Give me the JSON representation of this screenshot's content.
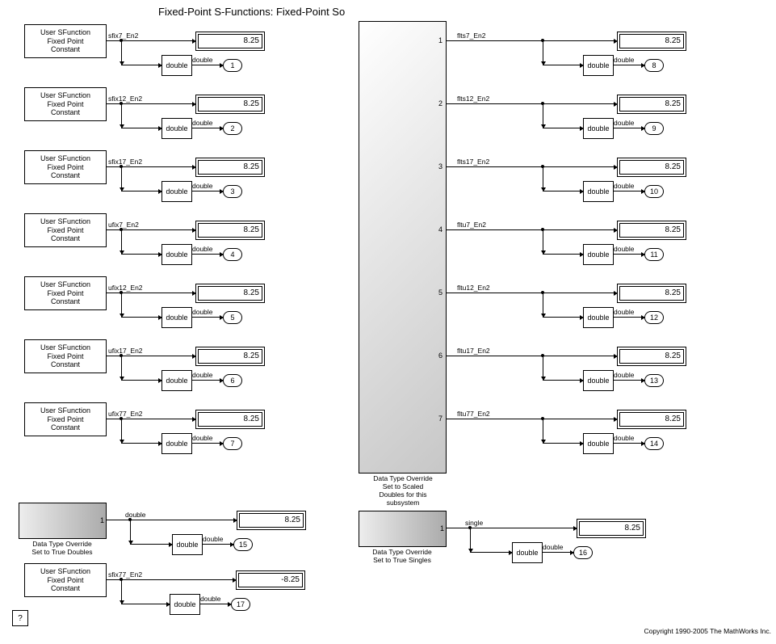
{
  "title": "Fixed-Point S-Functions: Fixed-Point So",
  "src_label": "User SFunction\nFixed Point\nConstant",
  "double_label": "double",
  "help": "?",
  "copyright": "Copyright 1990-2005 The MathWorks Inc.",
  "left_rows": [
    {
      "sig": "sfix7_En2",
      "disp": "8.25",
      "out": "1"
    },
    {
      "sig": "sfix12_En2",
      "disp": "8.25",
      "out": "2"
    },
    {
      "sig": "sfix17_En2",
      "disp": "8.25",
      "out": "3"
    },
    {
      "sig": "ufix7_En2",
      "disp": "8.25",
      "out": "4"
    },
    {
      "sig": "ufix12_En2",
      "disp": "8.25",
      "out": "5"
    },
    {
      "sig": "ufix17_En2",
      "disp": "8.25",
      "out": "6"
    },
    {
      "sig": "ufix77_En2",
      "disp": "8.25",
      "out": "7"
    }
  ],
  "sub1": {
    "caption": "Data Type Override\nSet to Scaled Doubles\nfor this subsystem"
  },
  "right_rows": [
    {
      "port": "1",
      "sig": "flts7_En2",
      "disp": "8.25",
      "out": "8"
    },
    {
      "port": "2",
      "sig": "flts12_En2",
      "disp": "8.25",
      "out": "9"
    },
    {
      "port": "3",
      "sig": "flts17_En2",
      "disp": "8.25",
      "out": "10"
    },
    {
      "port": "4",
      "sig": "fltu7_En2",
      "disp": "8.25",
      "out": "11"
    },
    {
      "port": "5",
      "sig": "fltu12_En2",
      "disp": "8.25",
      "out": "12"
    },
    {
      "port": "6",
      "sig": "fltu17_En2",
      "disp": "8.25",
      "out": "13"
    },
    {
      "port": "7",
      "sig": "fltu77_En2",
      "disp": "8.25",
      "out": "14"
    }
  ],
  "bot_left": {
    "caption": "Data Type Override\nSet to True Doubles",
    "port": "1",
    "sig": "double",
    "disp": "8.25",
    "out": "15"
  },
  "bot_right": {
    "caption": "Data Type Override\nSet to True Singles",
    "port": "1",
    "sig": "single",
    "disp": "8.25",
    "out": "16"
  },
  "bot_src": {
    "sig": "sfix77_En2",
    "disp": "-8.25",
    "out": "17"
  }
}
